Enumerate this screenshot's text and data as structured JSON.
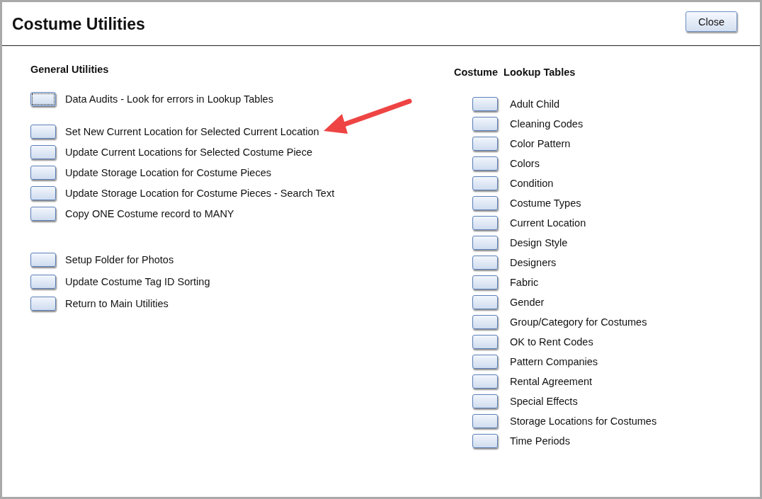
{
  "window": {
    "title": "Costume Utilities",
    "close_button": "Close"
  },
  "general_utilities": {
    "heading": "General Utilities",
    "groups": [
      [
        {
          "label": "Data Audits - Look for errors in Lookup Tables",
          "focused": true
        }
      ],
      [
        {
          "label": "Set New Current Location for Selected Current Location",
          "focused": false
        },
        {
          "label": "Update Current Locations for Selected Costume Piece",
          "focused": false
        },
        {
          "label": "Update Storage Location for Costume Pieces",
          "focused": false
        },
        {
          "label": "Update Storage Location for Costume Pieces - Search Text",
          "focused": false
        },
        {
          "label": "Copy ONE Costume record to MANY",
          "focused": false
        }
      ],
      [
        {
          "label": "Setup Folder for Photos",
          "focused": false
        },
        {
          "label": "Update Costume Tag ID Sorting",
          "focused": false
        },
        {
          "label": "Return to Main Utilities",
          "focused": false
        }
      ]
    ]
  },
  "lookup_tables": {
    "heading": "Costume  Lookup Tables",
    "items": [
      {
        "label": "Adult Child",
        "focused": false
      },
      {
        "label": "Cleaning Codes",
        "focused": false
      },
      {
        "label": "Color Pattern",
        "focused": false
      },
      {
        "label": "Colors",
        "focused": false
      },
      {
        "label": "Condition",
        "focused": false
      },
      {
        "label": "Costume Types",
        "focused": false
      },
      {
        "label": "Current Location",
        "focused": false
      },
      {
        "label": "Design Style",
        "focused": false
      },
      {
        "label": "Designers",
        "focused": false
      },
      {
        "label": "Fabric",
        "focused": false
      },
      {
        "label": "Gender",
        "focused": false
      },
      {
        "label": "Group/Category for Costumes",
        "focused": false
      },
      {
        "label": "OK to Rent Codes",
        "focused": false
      },
      {
        "label": "Pattern Companies",
        "focused": false
      },
      {
        "label": "Rental Agreement",
        "focused": false
      },
      {
        "label": "Special Effects",
        "focused": false
      },
      {
        "label": "Storage Locations for Costumes",
        "focused": false
      },
      {
        "label": "Time Periods",
        "focused": false
      }
    ]
  }
}
